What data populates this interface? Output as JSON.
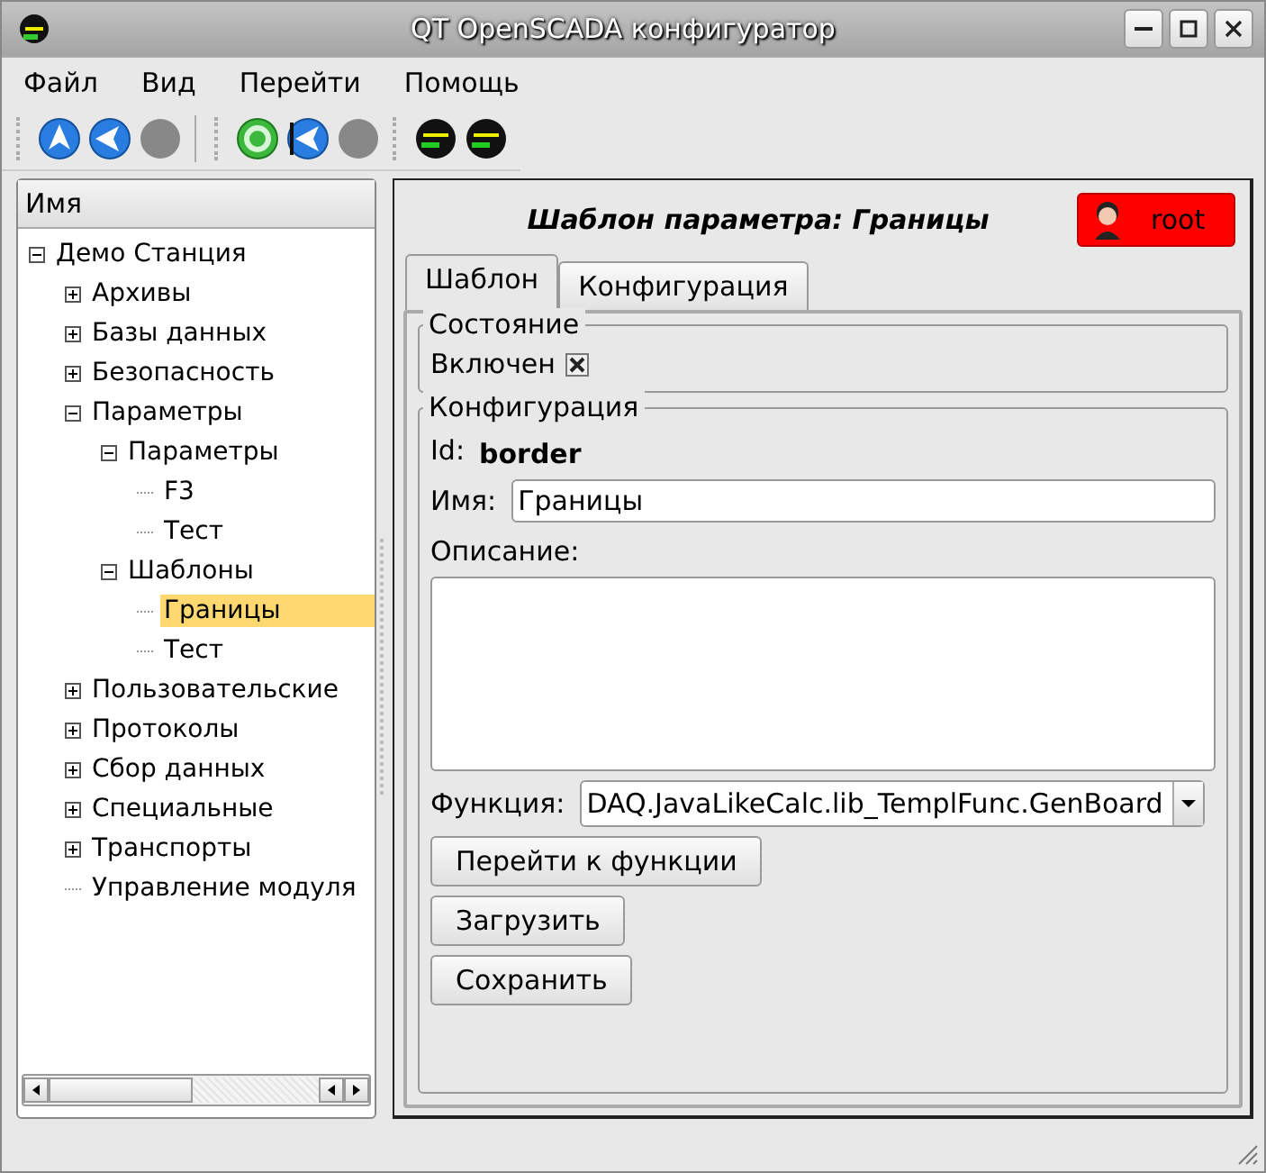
{
  "window": {
    "title": "QT OpenSCADA конфигуратор"
  },
  "menu": [
    {
      "label": "Файл"
    },
    {
      "label": "Вид"
    },
    {
      "label": "Перейти"
    },
    {
      "label": "Помощь"
    }
  ],
  "toolbar": [
    [
      {
        "kind": "up",
        "disabled": false
      },
      {
        "kind": "back",
        "disabled": false
      },
      {
        "kind": "stop",
        "disabled": true
      }
    ],
    [
      {
        "kind": "refresh",
        "disabled": false
      },
      {
        "kind": "forward",
        "disabled": false
      },
      {
        "kind": "stop",
        "disabled": true
      }
    ],
    [
      {
        "kind": "station",
        "disabled": false
      },
      {
        "kind": "station",
        "disabled": false
      }
    ]
  ],
  "tree": {
    "header": "Имя",
    "items": [
      {
        "label": "Демо Станция",
        "expanded": true,
        "selected": false,
        "children": [
          {
            "label": "Архивы",
            "expanded": false,
            "selected": false
          },
          {
            "label": "Базы данных",
            "expanded": false,
            "selected": false
          },
          {
            "label": "Безопасность",
            "expanded": false,
            "selected": false
          },
          {
            "label": "Параметры",
            "expanded": true,
            "selected": false,
            "children": [
              {
                "label": "Параметры",
                "expanded": true,
                "selected": false,
                "children": [
                  {
                    "label": "F3",
                    "selected": false
                  },
                  {
                    "label": "Тест",
                    "selected": false
                  }
                ]
              },
              {
                "label": "Шаблоны",
                "expanded": true,
                "selected": false,
                "children": [
                  {
                    "label": "Границы",
                    "selected": true
                  },
                  {
                    "label": "Тест",
                    "selected": false
                  }
                ]
              }
            ]
          },
          {
            "label": "Пользовательские",
            "expanded": false,
            "selected": false
          },
          {
            "label": "Протоколы",
            "expanded": false,
            "selected": false
          },
          {
            "label": "Сбор данных",
            "expanded": false,
            "selected": false
          },
          {
            "label": "Специальные",
            "expanded": false,
            "selected": false
          },
          {
            "label": "Транспорты",
            "expanded": false,
            "selected": false
          },
          {
            "label": "Управление модуля",
            "selected": false
          }
        ]
      }
    ]
  },
  "page": {
    "title": "Шаблон параметра: Границы",
    "user": "root",
    "tabs": [
      {
        "label": "Шаблон",
        "selected": true
      },
      {
        "label": "Конфигурация",
        "selected": false
      }
    ],
    "state_group": {
      "title": "Состояние",
      "enabled_label": "Включен",
      "checked": true
    },
    "config_group": {
      "title": "Конфигурация",
      "id_label": "Id:",
      "id_value": "border",
      "name_label": "Имя:",
      "name_value": "Границы",
      "description_label": "Описание:",
      "function_label": "Функция:",
      "function_value": "DAQ.JavaLikeCalc.lib_TemplFunc.GenBoard",
      "buttons": [
        "Перейти к функции",
        "Загрузить",
        "Сохранить"
      ]
    }
  }
}
